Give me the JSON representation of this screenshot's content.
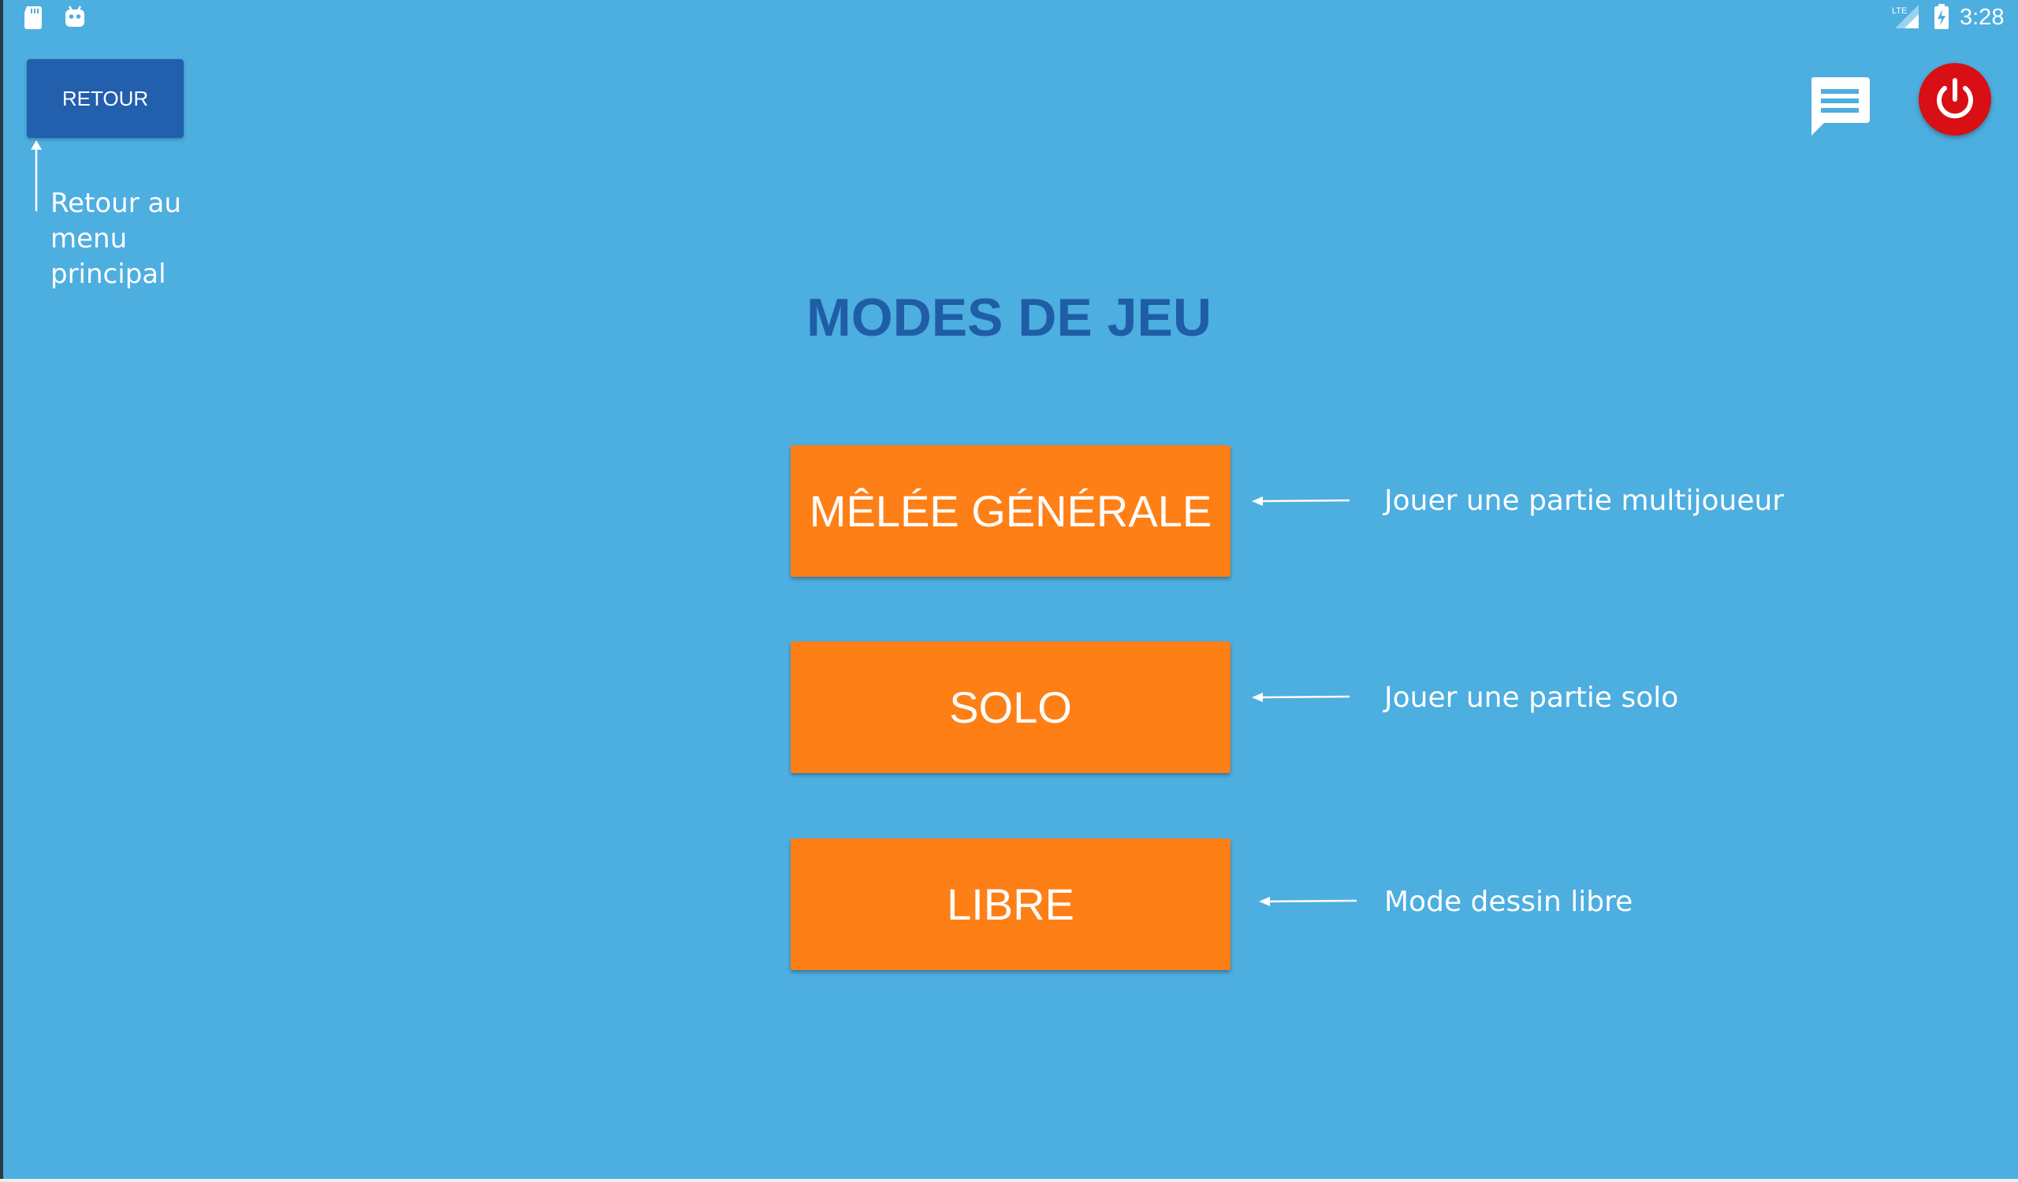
{
  "status_bar": {
    "time": "3:28",
    "icons": [
      "sd-card-icon",
      "android-icon",
      "lte-signal-icon",
      "battery-charging-icon"
    ]
  },
  "toolbar": {
    "back_label": "RETOUR",
    "back_note": "Retour au menu principal",
    "actions": [
      "chat-icon",
      "power-icon"
    ]
  },
  "main": {
    "title": "MODES DE JEU",
    "modes": [
      {
        "label": "MÊLÉE GÉNÉRALE",
        "description": "Jouer une partie multijoueur"
      },
      {
        "label": "SOLO",
        "description": "Jouer une partie solo"
      },
      {
        "label": "LIBRE",
        "description": "Mode dessin libre"
      }
    ]
  },
  "colors": {
    "background": "#4daee0",
    "back_button": "#225fad",
    "title": "#1f5ea6",
    "mode_button": "#ff7f17",
    "power_button": "#d80f14"
  }
}
